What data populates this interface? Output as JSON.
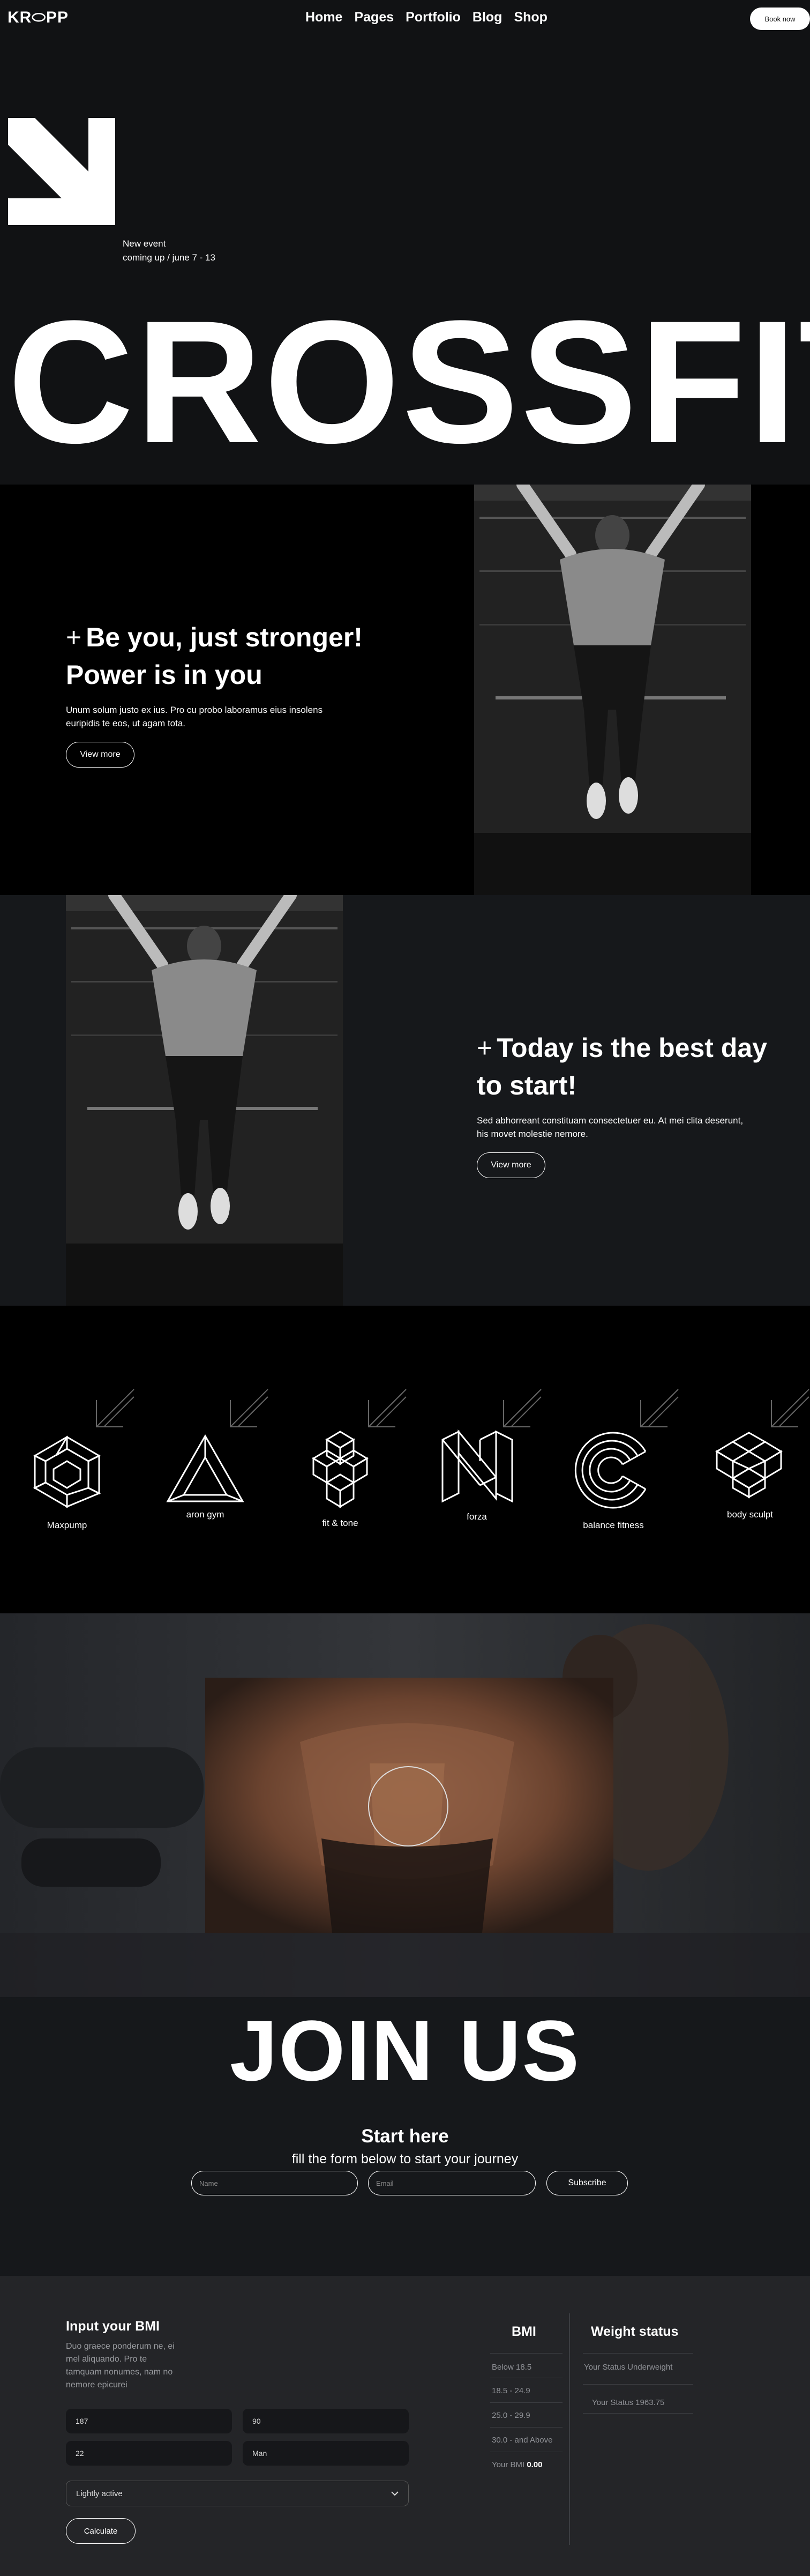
{
  "header": {
    "logo": "KR⬭PP",
    "nav": [
      "Home",
      "Pages",
      "Portfolio",
      "Blog",
      "Shop"
    ],
    "book_btn": "Book now"
  },
  "hero": {
    "event_line1": "New event",
    "event_line2": "coming up / june 7 - 13",
    "headline": "CROSSFIT"
  },
  "section_power": {
    "title_line1": "Be you, just stronger!",
    "title_line2": "Power is in you",
    "text": "Unum solum justo ex ius. Pro cu probo laboramus eius insolens euripidis te eos, ut agam tota.",
    "button": "View more"
  },
  "section_today": {
    "title_line1": "Today is the best day",
    "title_line2": "to start!",
    "text": "Sed abhorreant constituam consectetuer eu. At mei clita deserunt, his movet molestie nemore.",
    "button": "View more"
  },
  "brands": [
    "Maxpump",
    "aron gym",
    "fit & tone",
    "forza",
    "balance fitness",
    "body sculpt"
  ],
  "join": {
    "headline": "JOIN US",
    "subtitle": "Start here",
    "text": "fill the form below to start your journey",
    "name_placeholder": "Name",
    "email_placeholder": "Email",
    "subscribe": "Subscribe"
  },
  "bmi": {
    "title": "Input your BMI",
    "desc": "Duo graece ponderum ne, ei mel aliquando. Pro te tamquam nonumes, nam no nemore epicurei",
    "height": "187",
    "weight": "90",
    "age": "22",
    "sex": "Man",
    "activity": "Lightly active",
    "calculate": "Calculate",
    "table_h1": "BMI",
    "table_h2": "Weight status",
    "rows": [
      "Below 18.5",
      "18.5 - 24.9",
      "25.0 - 29.9",
      "30.0 - and Above"
    ],
    "your_bmi_label": "Your BMI",
    "your_bmi_value": "0.00",
    "status1": "Your Status Underweight",
    "status2": "Your Status 1963.75"
  }
}
